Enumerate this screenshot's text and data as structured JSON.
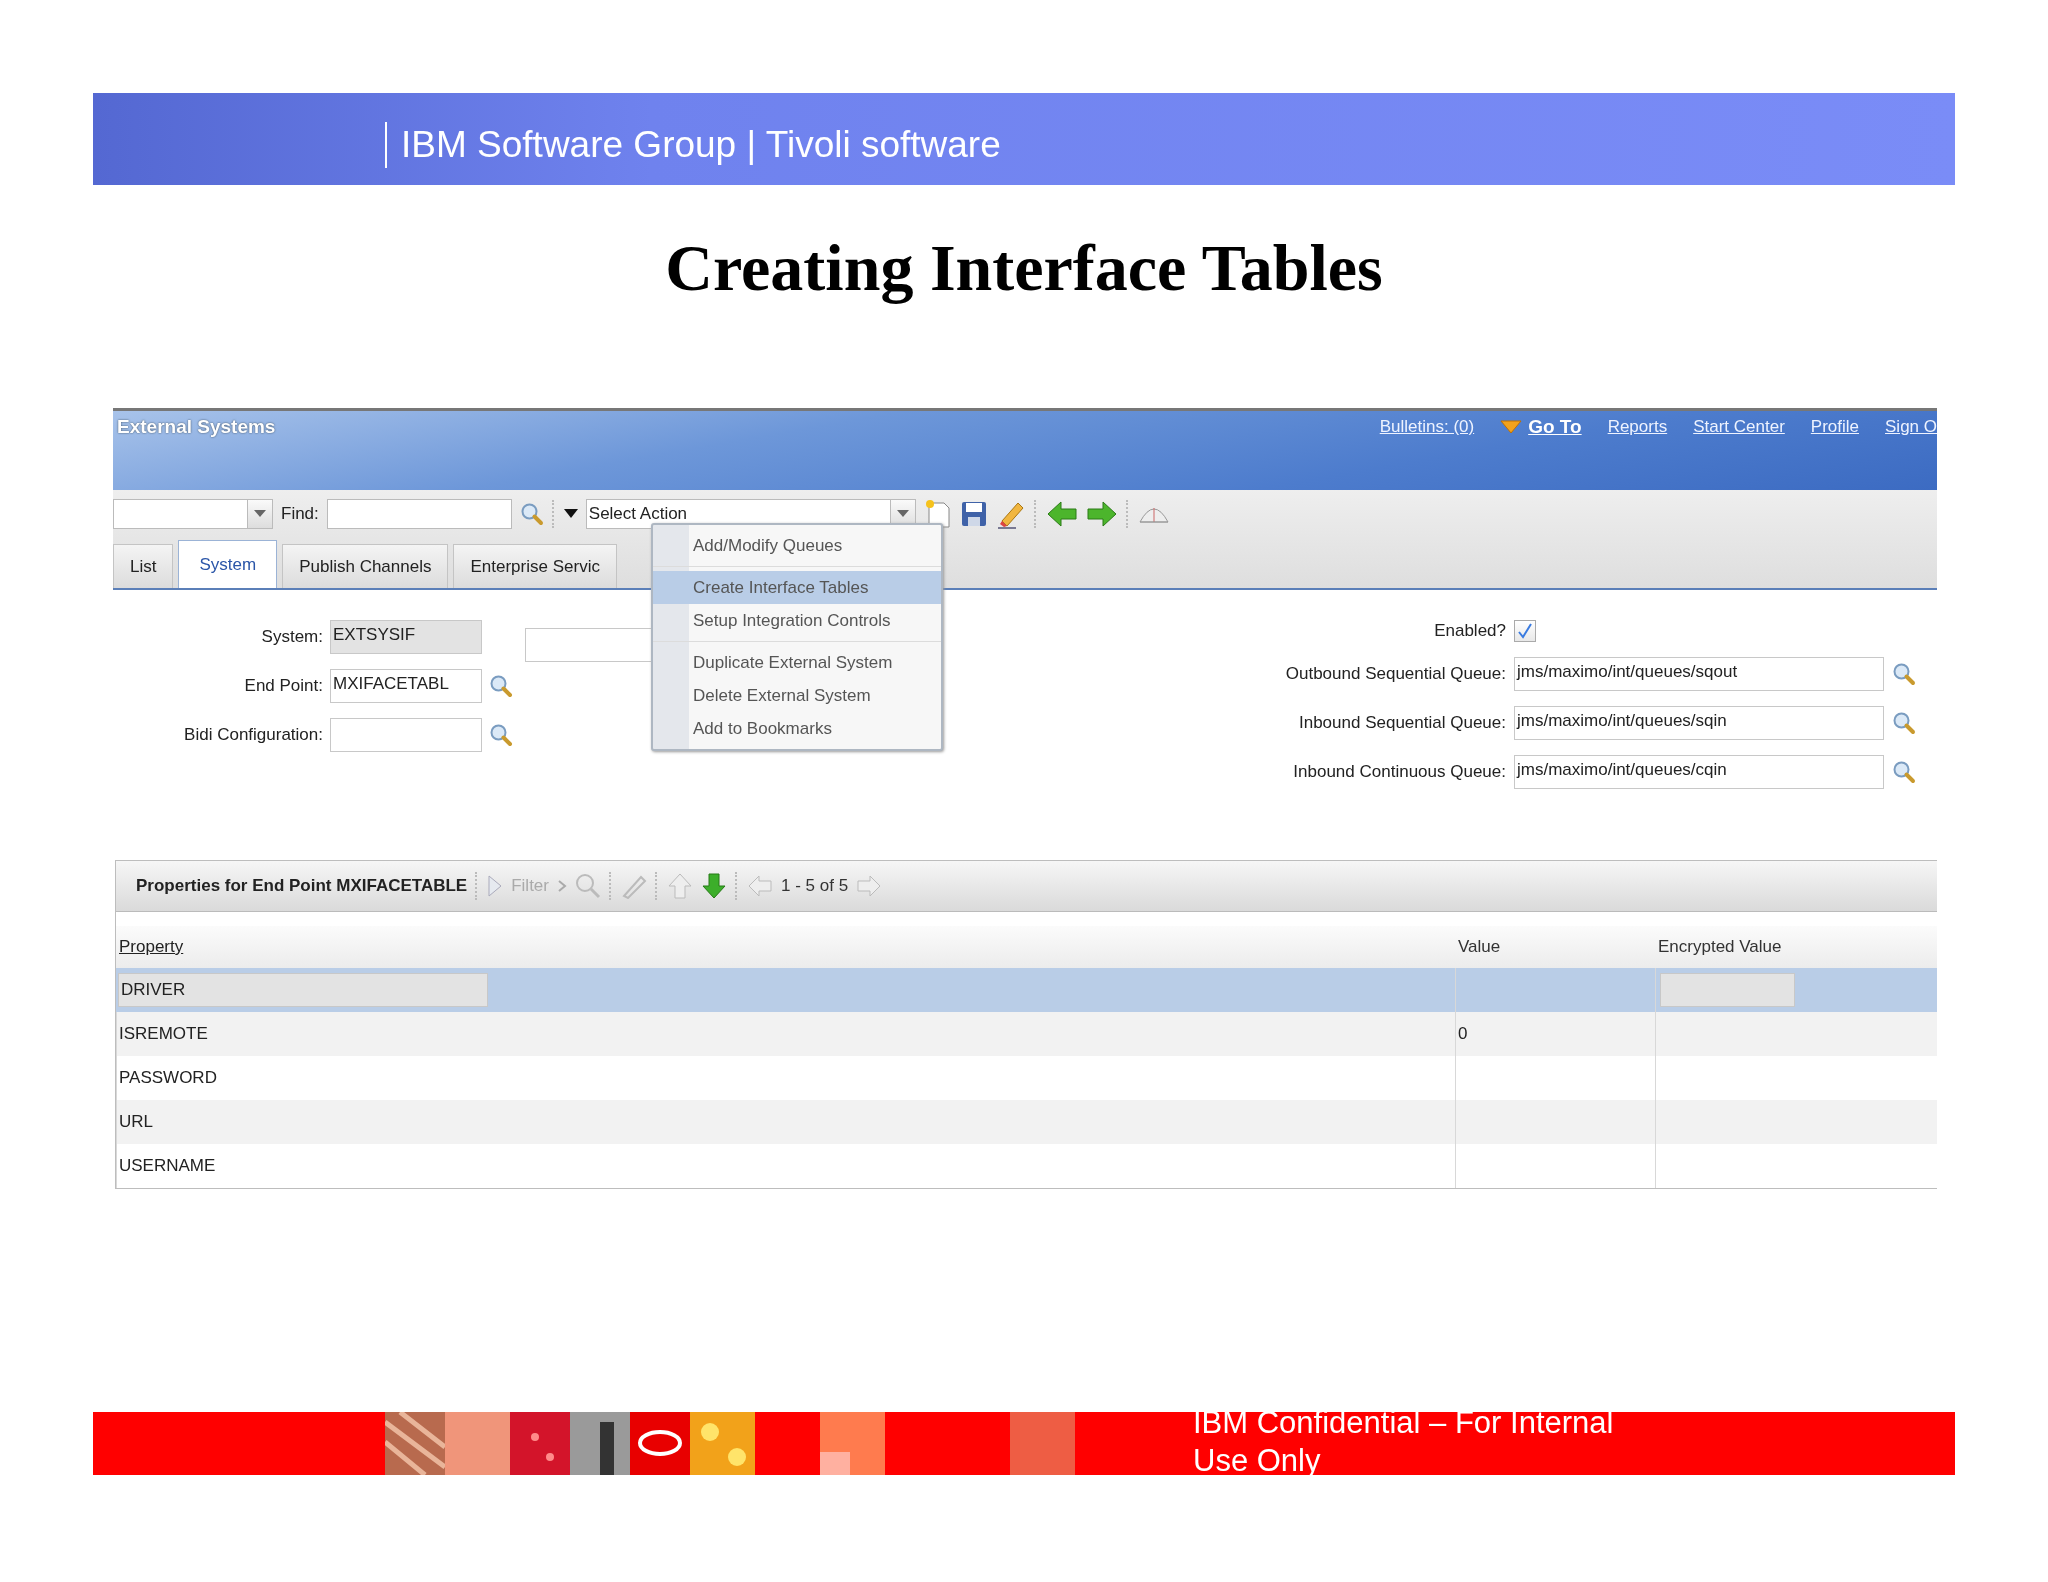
{
  "slide": {
    "header": "IBM Software Group | Tivoli software",
    "title": "Creating Interface Tables",
    "footer": "IBM Confidential – For Internal Use Only"
  },
  "app": {
    "title": "External Systems",
    "nav_links": [
      {
        "label": "Bulletins: (0)",
        "kind": "link"
      },
      {
        "label": "Go To",
        "kind": "menu"
      },
      {
        "label": "Reports",
        "kind": "link"
      },
      {
        "label": "Start Center",
        "kind": "link"
      },
      {
        "label": "Profile",
        "kind": "link"
      },
      {
        "label": "Sign O",
        "kind": "link"
      }
    ],
    "toolbar": {
      "find_label": "Find:",
      "action_select": "Select Action"
    },
    "tabs": [
      {
        "label": "List",
        "selected": false
      },
      {
        "label": "System",
        "selected": true
      },
      {
        "label": "Publish Channels",
        "selected": false
      },
      {
        "label": "Enterprise Servic",
        "selected": false
      }
    ],
    "action_menu": {
      "groups": [
        [
          {
            "label": "Add/Modify Queues",
            "selected": false
          }
        ],
        [
          {
            "label": "Create Interface Tables",
            "selected": true
          },
          {
            "label": "Setup Integration Controls",
            "selected": false
          }
        ],
        [
          {
            "label": "Duplicate External System",
            "selected": false
          },
          {
            "label": "Delete External System",
            "selected": false
          },
          {
            "label": "Add to Bookmarks",
            "selected": false
          }
        ]
      ]
    },
    "left_fields": [
      {
        "label": "System:",
        "value": "EXTSYSIF",
        "readonly": true,
        "lookup": false
      },
      {
        "label": "End Point:",
        "value": "MXIFACETABL",
        "readonly": false,
        "lookup": true
      },
      {
        "label": "Bidi Configuration:",
        "readonly": false,
        "lookup": true
      }
    ],
    "enabled": {
      "label": "Enabled?",
      "checked": true
    },
    "queue_fields": [
      {
        "label": "Outbound Sequential Queue:",
        "value": "jms/maximo/int/queues/sqout"
      },
      {
        "label": "Inbound Sequential Queue:",
        "value": "jms/maximo/int/queues/sqin"
      },
      {
        "label": "Inbound Continuous Queue:",
        "value": "jms/maximo/int/queues/cqin"
      }
    ],
    "table": {
      "title": "Properties for End Point MXIFACETABLE",
      "filter": "Filter",
      "paging": "1 - 5 of 5",
      "columns": [
        "Property",
        "Value",
        "Encrypted Value"
      ],
      "rows": [
        {
          "property": "DRIVER",
          "selected": true
        },
        {
          "property": "ISREMOTE",
          "value": "0",
          "selected": false
        },
        {
          "property": "PASSWORD",
          "selected": false
        },
        {
          "property": "URL",
          "selected": false
        },
        {
          "property": "USERNAME",
          "selected": false
        }
      ]
    }
  }
}
